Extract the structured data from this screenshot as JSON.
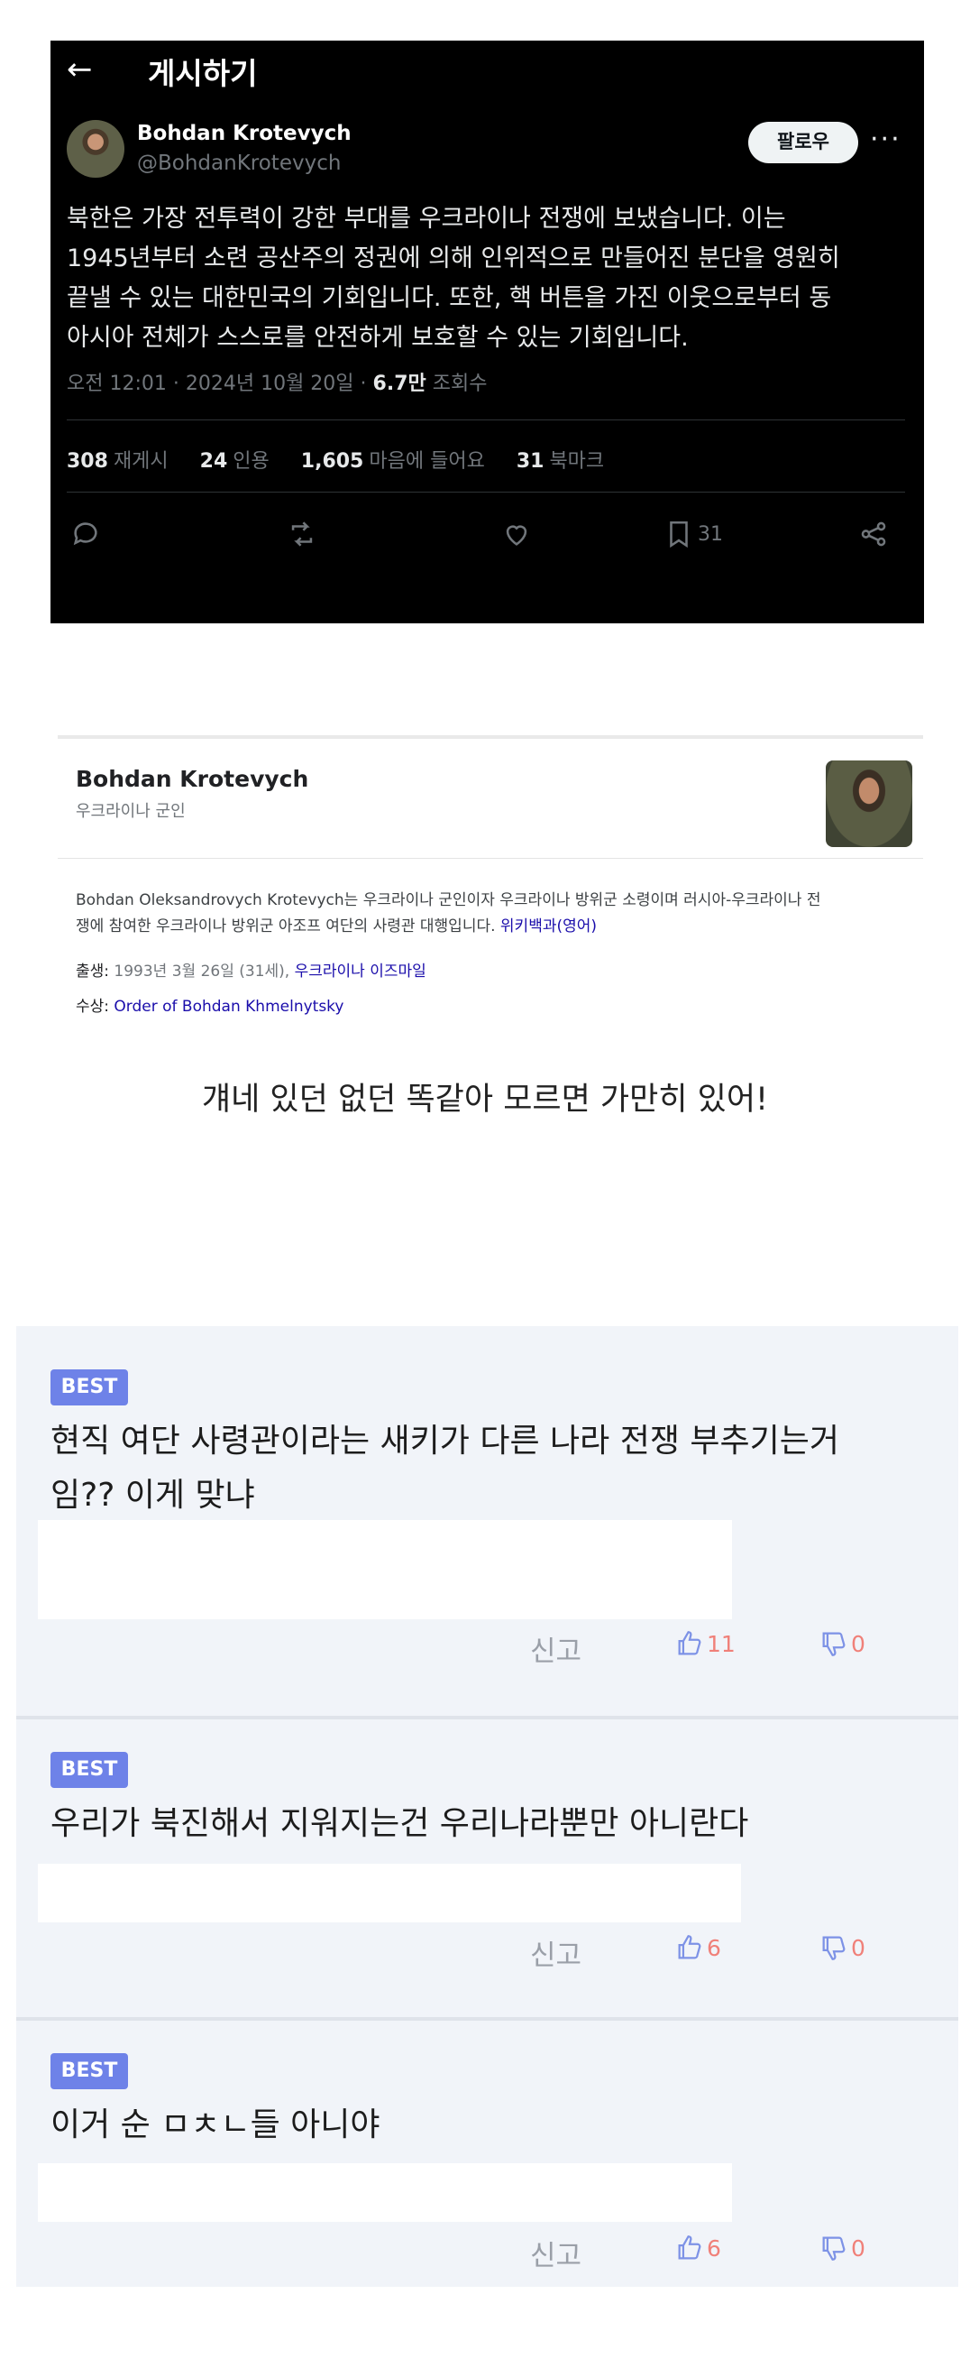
{
  "tweet": {
    "back_icon": "arrow-left-icon",
    "header_title": "게시하기",
    "author_name": "Bohdan Krotevych",
    "author_handle": "@BohdanKrotevych",
    "follow_label": "팔로우",
    "more_label": "···",
    "body_lines": [
      "북한은 가장 전투력이 강한 부대를 우크라이나 전쟁에 보냈습니다. 이는",
      "1945년부터 소련 공산주의 정권에 의해 인위적으로 만들어진 분단을 영원히",
      "끝낼 수 있는 대한민국의 기회입니다. 또한, 핵 버튼을 가진 이웃으로부터 동",
      "아시아 전체가 스스로를 안전하게 보호할 수 있는 기회입니다."
    ],
    "meta_time": "오전 12:01 · 2024년 10월 20일 · ",
    "meta_views": "6.7만",
    "meta_views_label": " 조회수",
    "stats": {
      "reposts": "308",
      "reposts_label": "재게시",
      "quotes": "24",
      "quotes_label": "인용",
      "likes": "1,605",
      "likes_label": "마음에 들어요",
      "bookmarks": "31",
      "bookmarks_label": "북마크"
    },
    "actions": {
      "reply_icon": "comment-icon",
      "repost_icon": "repost-icon",
      "like_icon": "heart-icon",
      "bookmark_icon": "bookmark-icon",
      "bookmark_count": "31",
      "share_icon": "share-icon"
    }
  },
  "wiki": {
    "name": "Bohdan Krotevych",
    "role": "우크라이나 군인",
    "desc_line1": "Bohdan Oleksandrovych Krotevych는 우크라이나 군인이자 우크라이나 방위군 소령이며 러시아-우크라이나 전",
    "desc_line2": "쟁에 참여한 우크라이나 방위군 아조프 여단의 사령관 대행입니다.",
    "desc_link": "위키백과(영어)",
    "born_label": "출생:",
    "born_value": "1993년 3월 26일 (31세),",
    "born_place": "우크라이나 이즈마일",
    "award_label": "수상:",
    "award_value": "Order of Bohdan Khmelnytsky"
  },
  "caption": "걔네 있던 없던 똑같아 모르면 가만히 있어!",
  "comments": [
    {
      "badge": "BEST",
      "text_line1": "현직 여단 사령관이라는 새키가 다른 나라 전쟁 부추기는거",
      "text_line2": "임?? 이게 맞냐",
      "report": "신고",
      "likes": "11",
      "dislikes": "0"
    },
    {
      "badge": "BEST",
      "text_line1": "우리가 북진해서 지워지는건 우리나라뿐만 아니란다",
      "report": "신고",
      "likes": "6",
      "dislikes": "0"
    },
    {
      "badge": "BEST",
      "text_line1": "이거 순 ㅁㅊㄴ들 아니야",
      "report": "신고",
      "likes": "6",
      "dislikes": "0"
    }
  ],
  "colors": {
    "tweet_bg": "#000000",
    "badge_bg": "#6e82e8",
    "vote_color": "#f08079",
    "comments_bg": "#f1f4f9"
  }
}
